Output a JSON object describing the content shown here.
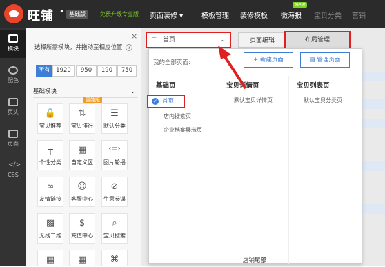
{
  "topbar": {
    "brand": "旺铺",
    "dot": "•",
    "edition": "基础版",
    "upgrade": "免费升级专业版",
    "nav": [
      {
        "label": "页面装修 ▾"
      },
      {
        "label": "模板管理"
      },
      {
        "label": "装修模板"
      },
      {
        "label": "微海报"
      },
      {
        "label": "宝贝分类"
      },
      {
        "label": "营销"
      }
    ],
    "new_badge": "New"
  },
  "sidebar": {
    "items": [
      {
        "label": "模块",
        "icon": "grid-icon"
      },
      {
        "label": "配色",
        "icon": "palette-icon"
      },
      {
        "label": "页头",
        "icon": "header-icon"
      },
      {
        "label": "页面",
        "icon": "page-icon"
      },
      {
        "label": "CSS",
        "icon": "code-icon"
      }
    ]
  },
  "panel": {
    "close": "×",
    "hint": "选择所需模块，并拖动至相应位置",
    "help_icon": "?",
    "width_tabs": [
      "所有",
      "1920",
      "950",
      "190",
      "750"
    ],
    "section_title": "基础模块",
    "section_toggle": "⌄",
    "smart_badge": "智能版",
    "modules": [
      {
        "label": "宝贝推荐",
        "glyph": "🔒"
      },
      {
        "label": "宝贝排行",
        "glyph": "⇅"
      },
      {
        "label": "默认分类",
        "glyph": "☰"
      },
      {
        "label": "个性分类",
        "glyph": "┬"
      },
      {
        "label": "自定义区",
        "glyph": "▦"
      },
      {
        "label": "图片轮播",
        "glyph": "‹▭›"
      },
      {
        "label": "友情链接",
        "glyph": "∞"
      },
      {
        "label": "客服中心",
        "glyph": "☺"
      },
      {
        "label": "生意参谋",
        "glyph": "⊘"
      },
      {
        "label": "无线二维",
        "glyph": "▩"
      },
      {
        "label": "充值中心",
        "glyph": "$"
      },
      {
        "label": "宝贝搜索",
        "glyph": "⌕"
      },
      {
        "label": "",
        "glyph": "▦"
      },
      {
        "label": "",
        "glyph": "▦"
      },
      {
        "label": "",
        "glyph": "⌘"
      }
    ]
  },
  "toolbar": {
    "page_select": "首页",
    "page_select_chevron": "⌄",
    "page_edit": "页面编辑",
    "layout_manage": "布局管理"
  },
  "dropdown": {
    "all_pages": "我的全部页面:",
    "new_page": "+ 新建页面",
    "manage_pages": "管理页面",
    "columns": [
      {
        "title": "基础页",
        "items": [
          "首页",
          "店内搜索页",
          "企业档案展示页"
        ]
      },
      {
        "title": "宝贝详情页",
        "items": [
          "默认宝贝详情页"
        ]
      },
      {
        "title": "宝贝列表页",
        "items": [
          "默认宝贝分类页"
        ]
      }
    ]
  },
  "canvas": {
    "footer_label": "店铺尾部"
  },
  "colors": {
    "accent": "#3d7fd6",
    "highlight": "#e02020",
    "topbar": "#2b2b2b"
  }
}
